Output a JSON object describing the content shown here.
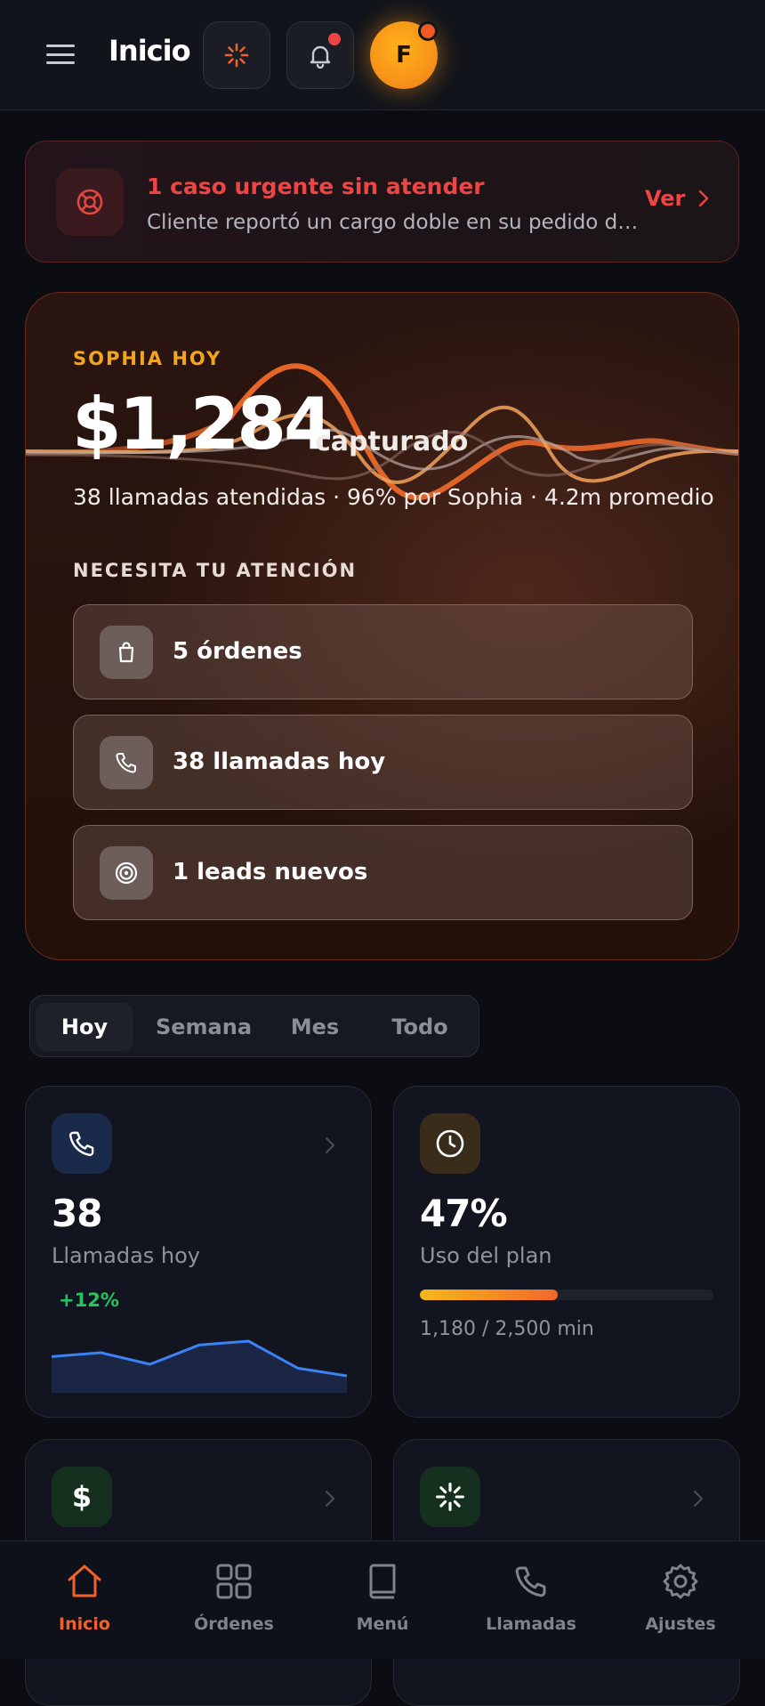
{
  "header": {
    "title": "Inicio",
    "menu_icon": "hamburger-menu-icon",
    "activity_icon": "sparkle-activity-icon",
    "notifications_icon": "bell-icon",
    "avatar_initial": "F"
  },
  "alert": {
    "icon": "lifebuoy-icon",
    "title": "1 caso urgente sin atender",
    "description": "Cliente reportó un cargo doble en su pedido del vi...",
    "link_label": "Ver",
    "color": "#ef4444"
  },
  "hero": {
    "label": "SOPHIA HOY",
    "amount": "$1,284",
    "amount_suffix": "capturado",
    "stats": "38 llamadas atendidas · 96% por Sophia · 4.2m promedio",
    "attention_title": "NECESITA TU ATENCIÓN",
    "attention_items": [
      {
        "label": "5 órdenes",
        "icon": "shopping-bag-icon"
      },
      {
        "label": "38 llamadas hoy",
        "icon": "phone-icon"
      },
      {
        "label": "1 leads nuevos",
        "icon": "target-icon"
      }
    ],
    "accent": "#f4a51c"
  },
  "period_tabs": [
    {
      "label": "Hoy",
      "active": true
    },
    {
      "label": "Semana",
      "active": false
    },
    {
      "label": "Mes",
      "active": false
    },
    {
      "label": "Todo",
      "active": false
    }
  ],
  "cards": [
    {
      "icon": "phone-icon",
      "value": "38",
      "label": "Llamadas hoy",
      "trend": "+12%",
      "sparkline": [
        8,
        9,
        6,
        11,
        12,
        5,
        3
      ]
    },
    {
      "icon": "clock-icon",
      "value": "47%",
      "label": "Uso del plan",
      "progress": 0.47,
      "usage": "1,180 / 2,500 min"
    },
    {
      "icon": "dollar-icon"
    },
    {
      "icon": "sparkle-icon"
    }
  ],
  "bottom_nav": [
    {
      "label": "Inicio",
      "icon": "home-icon",
      "active": true
    },
    {
      "label": "Órdenes",
      "icon": "grid-icon",
      "active": false
    },
    {
      "label": "Menú",
      "icon": "book-icon",
      "active": false
    },
    {
      "label": "Llamadas",
      "icon": "phone-icon",
      "active": false
    },
    {
      "label": "Ajustes",
      "icon": "gear-icon",
      "active": false
    }
  ],
  "colors": {
    "brand_orange": "#f0622a",
    "success": "#22c55e",
    "danger": "#ef4444"
  }
}
